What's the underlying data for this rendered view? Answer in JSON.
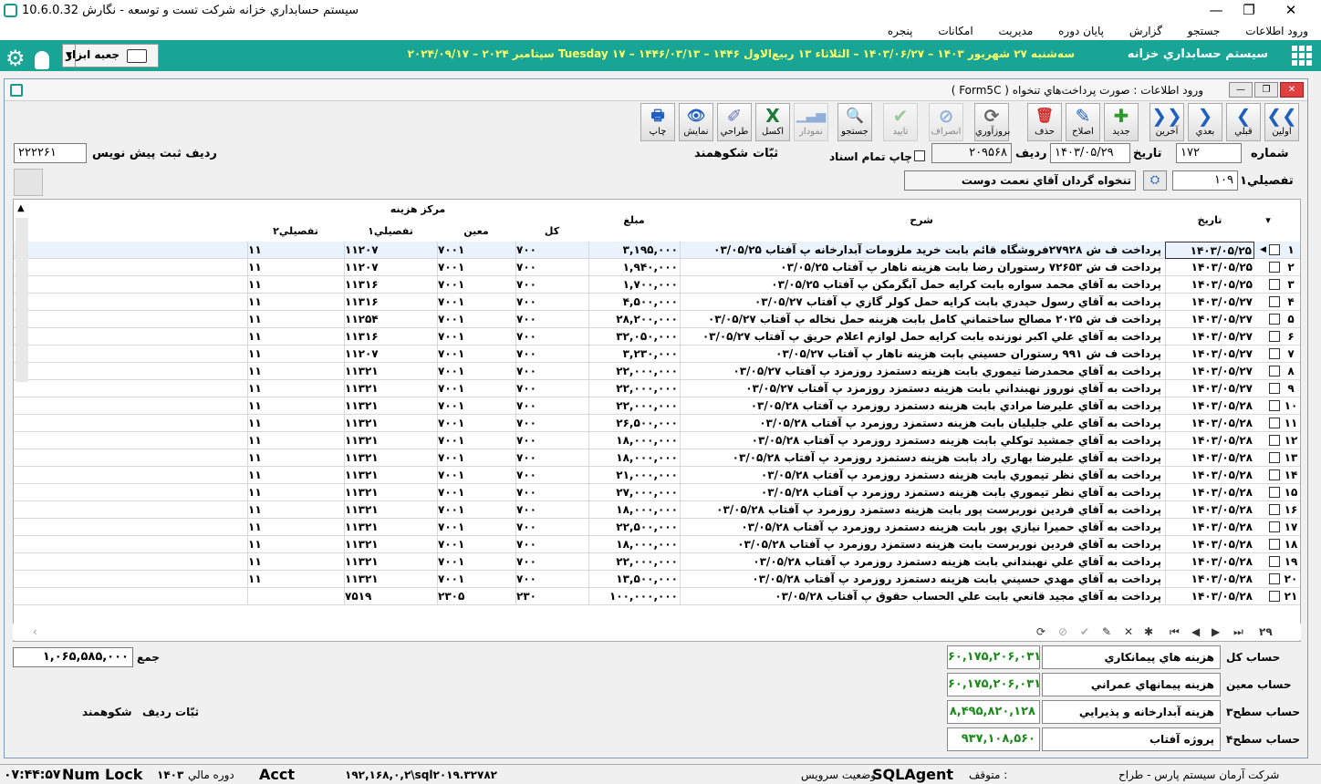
{
  "window": {
    "title": "سيستم حسابداري خزانه شرکت تست و توسعه - نگارش 10.6.0.32",
    "minimize": "—",
    "restore": "❐",
    "close": "✕"
  },
  "menu": [
    "ورود اطلاعات",
    "جستجو",
    "گزارش",
    "پايان دوره",
    "مديريت",
    "امکانات",
    "پنجره"
  ],
  "banner": {
    "system_name": "سيستم حسابداري خزانه",
    "date_line": "سه‌شنبه ۲۷ شهريور ۱۴۰۳ – ۱۴۰۳/۰۶/۲۷ – الثلاثاء ۱۳ ربيع‌الاول ۱۴۴۶ – ۱۴۴۶/۰۳/۱۳ – Tuesday ۱۷ سپتامبر ۲۰۲۴ – ۲۰۲۴/۰۹/۱۷",
    "toolbox_label": "جعبه ابزار",
    "toolbox_arrow": "▼"
  },
  "form": {
    "title": "ورود اطلاعات : صورت پرداخت‌هاي تنخواه ( Form5C )",
    "toolbar": [
      {
        "label": "اولين",
        "icon": "❮❮"
      },
      {
        "label": "قبلي",
        "icon": "❮"
      },
      {
        "label": "بعدي",
        "icon": "❯"
      },
      {
        "label": "آخرين",
        "icon": "❯❯"
      },
      {
        "label": "جديد",
        "icon": "✚"
      },
      {
        "label": "اصلاح",
        "icon": "✎"
      },
      {
        "label": "حذف",
        "icon": "🗑"
      },
      {
        "label": "بروزآوري",
        "icon": "⟳"
      },
      {
        "label": "انصراف",
        "icon": "⊘"
      },
      {
        "label": "تاييد",
        "icon": "✔"
      },
      {
        "label": "جستجو",
        "icon": "🔍"
      },
      {
        "label": "نمودار",
        "icon": "▁▃▅"
      },
      {
        "label": "اکسل",
        "icon": "X"
      },
      {
        "label": "طراحي",
        "icon": "✐"
      },
      {
        "label": "نمايش",
        "icon": "👁"
      },
      {
        "label": "چاپ",
        "icon": "🖶"
      }
    ],
    "header": {
      "number_label": "شماره",
      "number_value": "۱۷۲",
      "date_label": "تاريخ",
      "date_value": "۱۴۰۳/۰۵/۲۹",
      "row_label": "رديف",
      "row_value": "۲۰۹۵۶۸",
      "print_all_label": "چاپ تمام اسناد",
      "recorder_label": "ثبّات",
      "recorder_value": "شکوهمند",
      "prefill_label": "رديف ثبت پيش نويس",
      "prefill_value": "۲۲۲۲۶۱",
      "tafsili_label": "تفصيلي۱",
      "tafsili_code": "۱۰۹",
      "tafsili_name": "تنخواه گردان آقاي نعمت دوست"
    },
    "grid": {
      "headers": {
        "date": "تاريخ",
        "desc": "شرح",
        "amount": "مبلغ",
        "cost_center": "مرکز هزينه",
        "kol": "کل",
        "moeen": "معين",
        "tafsili1": "تفصيلي۱",
        "tafsili2": "تفصيلي۲"
      },
      "rows": [
        {
          "n": "۱",
          "date": "۱۴۰۳/۰۵/۲۵",
          "desc": "پرداخت ف ش ۲۷۹۲۸فروشگاه قائم بابت خريد ملزومات آبدارخانه پ آفتاب ۰۳/۰۵/۲۵",
          "amount": "۳,۱۹۵,۰۰۰",
          "kol": "۷۰۰",
          "moeen": "۷۰۰۱",
          "t1": "۱۱۲۰۷",
          "t2": "۱۱"
        },
        {
          "n": "۲",
          "date": "۱۴۰۳/۰۵/۲۵",
          "desc": "پرداخت ف ش ۷۲۶۵۳ رستوران رضا بابت هزينه ناهار پ آفتاب ۰۳/۰۵/۲۵",
          "amount": "۱,۹۴۰,۰۰۰",
          "kol": "۷۰۰",
          "moeen": "۷۰۰۱",
          "t1": "۱۱۲۰۷",
          "t2": "۱۱"
        },
        {
          "n": "۳",
          "date": "۱۴۰۳/۰۵/۲۵",
          "desc": "پرداخت به آقاي محمد سواره بابت کرايه حمل آبگرمکن پ آفتاب ۰۳/۰۵/۲۵",
          "amount": "۱,۷۰۰,۰۰۰",
          "kol": "۷۰۰",
          "moeen": "۷۰۰۱",
          "t1": "۱۱۳۱۶",
          "t2": "۱۱"
        },
        {
          "n": "۴",
          "date": "۱۴۰۳/۰۵/۲۷",
          "desc": "پرداخت به آقاي رسول حيدري بابت کرايه حمل کولر گازي پ آفتاب ۰۳/۰۵/۲۷",
          "amount": "۴,۵۰۰,۰۰۰",
          "kol": "۷۰۰",
          "moeen": "۷۰۰۱",
          "t1": "۱۱۳۱۶",
          "t2": "۱۱"
        },
        {
          "n": "۵",
          "date": "۱۴۰۳/۰۵/۲۷",
          "desc": "پرداخت ف ش ۲۰۲۵ مصالح ساختماني کامل بابت هزينه حمل نخاله پ آفتاب ۰۳/۰۵/۲۷",
          "amount": "۲۸,۲۰۰,۰۰۰",
          "kol": "۷۰۰",
          "moeen": "۷۰۰۱",
          "t1": "۱۱۲۵۴",
          "t2": "۱۱"
        },
        {
          "n": "۶",
          "date": "۱۴۰۳/۰۵/۲۷",
          "desc": "پرداخت به آقاي علي اکبر نوزنده بابت کرايه حمل لوازم اعلام حريق پ آفتاب ۰۳/۰۵/۲۷",
          "amount": "۳۲,۰۵۰,۰۰۰",
          "kol": "۷۰۰",
          "moeen": "۷۰۰۱",
          "t1": "۱۱۳۱۶",
          "t2": "۱۱"
        },
        {
          "n": "۷",
          "date": "۱۴۰۳/۰۵/۲۷",
          "desc": "پرداخت ف ش ۹۹۱ رستوران حسيني بابت هزينه ناهار پ آفتاب ۰۳/۰۵/۲۷",
          "amount": "۳,۲۳۰,۰۰۰",
          "kol": "۷۰۰",
          "moeen": "۷۰۰۱",
          "t1": "۱۱۲۰۷",
          "t2": "۱۱"
        },
        {
          "n": "۸",
          "date": "۱۴۰۳/۰۵/۲۷",
          "desc": "پرداخت به آقاي محمدرضا تيموري بابت هزينه دستمزد روزمزد پ آفتاب ۰۳/۰۵/۲۷",
          "amount": "۲۲,۰۰۰,۰۰۰",
          "kol": "۷۰۰",
          "moeen": "۷۰۰۱",
          "t1": "۱۱۳۲۱",
          "t2": "۱۱"
        },
        {
          "n": "۹",
          "date": "۱۴۰۳/۰۵/۲۷",
          "desc": "پرداخت به آقاي نوروز نهبنداني بابت هزينه دستمزد روزمزد پ آفتاب ۰۳/۰۵/۲۷",
          "amount": "۲۲,۰۰۰,۰۰۰",
          "kol": "۷۰۰",
          "moeen": "۷۰۰۱",
          "t1": "۱۱۳۲۱",
          "t2": "۱۱"
        },
        {
          "n": "۱۰",
          "date": "۱۴۰۳/۰۵/۲۸",
          "desc": "پرداخت به آقاي عليرضا مرادي بابت هزينه دستمزد روزمرد پ آفتاب ۰۳/۰۵/۲۸",
          "amount": "۲۲,۰۰۰,۰۰۰",
          "kol": "۷۰۰",
          "moeen": "۷۰۰۱",
          "t1": "۱۱۳۲۱",
          "t2": "۱۱"
        },
        {
          "n": "۱۱",
          "date": "۱۴۰۳/۰۵/۲۸",
          "desc": "پرداخت به آقاي علي جليليان بابت هزينه دستمزد روزمرد پ آفتاب ۰۳/۰۵/۲۸",
          "amount": "۲۶,۵۰۰,۰۰۰",
          "kol": "۷۰۰",
          "moeen": "۷۰۰۱",
          "t1": "۱۱۳۲۱",
          "t2": "۱۱"
        },
        {
          "n": "۱۲",
          "date": "۱۴۰۳/۰۵/۲۸",
          "desc": "پرداخت به آقاي جمشيد توکلي بابت هزينه دستمزد روزمرد پ آفتاب ۰۳/۰۵/۲۸",
          "amount": "۱۸,۰۰۰,۰۰۰",
          "kol": "۷۰۰",
          "moeen": "۷۰۰۱",
          "t1": "۱۱۳۲۱",
          "t2": "۱۱"
        },
        {
          "n": "۱۳",
          "date": "۱۴۰۳/۰۵/۲۸",
          "desc": "پرداخت به آقاي عليرضا بهاري راد بابت هزينه دستمزد روزمرد پ آفتاب ۰۳/۰۵/۲۸",
          "amount": "۱۸,۰۰۰,۰۰۰",
          "kol": "۷۰۰",
          "moeen": "۷۰۰۱",
          "t1": "۱۱۳۲۱",
          "t2": "۱۱"
        },
        {
          "n": "۱۴",
          "date": "۱۴۰۳/۰۵/۲۸",
          "desc": "پرداخت به آقاي نظر تيموري بابت هزينه دستمزد روزمرد پ آفتاب ۰۳/۰۵/۲۸",
          "amount": "۲۱,۰۰۰,۰۰۰",
          "kol": "۷۰۰",
          "moeen": "۷۰۰۱",
          "t1": "۱۱۳۲۱",
          "t2": "۱۱"
        },
        {
          "n": "۱۵",
          "date": "۱۴۰۳/۰۵/۲۸",
          "desc": "پرداخت به آقاي نظر تيموري بابت هزينه دستمزد روزمرد پ آفتاب ۰۳/۰۵/۲۸",
          "amount": "۲۷,۰۰۰,۰۰۰",
          "kol": "۷۰۰",
          "moeen": "۷۰۰۱",
          "t1": "۱۱۳۲۱",
          "t2": "۱۱"
        },
        {
          "n": "۱۶",
          "date": "۱۴۰۳/۰۵/۲۸",
          "desc": "پرداخت به آقاي فردين نوربرست پور بابت هزينه دستمزد روزمرد پ آفتاب ۰۳/۰۵/۲۸",
          "amount": "۱۸,۰۰۰,۰۰۰",
          "kol": "۷۰۰",
          "moeen": "۷۰۰۱",
          "t1": "۱۱۳۲۱",
          "t2": "۱۱"
        },
        {
          "n": "۱۷",
          "date": "۱۴۰۳/۰۵/۲۸",
          "desc": "پرداخت به آقاي حميرا نيازي پور بابت هزينه دستمزد روزمرد پ آفتاب ۰۳/۰۵/۲۸",
          "amount": "۲۲,۵۰۰,۰۰۰",
          "kol": "۷۰۰",
          "moeen": "۷۰۰۱",
          "t1": "۱۱۳۲۱",
          "t2": "۱۱"
        },
        {
          "n": "۱۸",
          "date": "۱۴۰۳/۰۵/۲۸",
          "desc": "پرداخت به آقاي فردين نوربرست بابت هزينه دستمزد روزمرد پ آفتاب ۰۳/۰۵/۲۸",
          "amount": "۱۸,۰۰۰,۰۰۰",
          "kol": "۷۰۰",
          "moeen": "۷۰۰۱",
          "t1": "۱۱۳۲۱",
          "t2": "۱۱"
        },
        {
          "n": "۱۹",
          "date": "۱۴۰۳/۰۵/۲۸",
          "desc": "پرداخت به آقاي علي نهبنداني بابت هزينه دستمزد روزمرد پ آفتاب ۰۳/۰۵/۲۸",
          "amount": "۲۲,۰۰۰,۰۰۰",
          "kol": "۷۰۰",
          "moeen": "۷۰۰۱",
          "t1": "۱۱۳۲۱",
          "t2": "۱۱"
        },
        {
          "n": "۲۰",
          "date": "۱۴۰۳/۰۵/۲۸",
          "desc": "پرداخت به آقاي مهدي حسيني بابت هزينه دستمزد روزمرد پ آفتاب ۰۳/۰۵/۲۸",
          "amount": "۱۳,۵۰۰,۰۰۰",
          "kol": "۷۰۰",
          "moeen": "۷۰۰۱",
          "t1": "۱۱۳۲۱",
          "t2": "۱۱"
        },
        {
          "n": "۲۱",
          "date": "۱۴۰۳/۰۵/۲۸",
          "desc": "پرداخت به آقاي مجيد قانعي بابت علي الحساب حقوق پ آفتاب ۰۳/۰۵/۲۸",
          "amount": "۱۰۰,۰۰۰,۰۰۰",
          "kol": "۲۳۰",
          "moeen": "۲۳۰۵",
          "t1": "۷۵۱۹",
          "t2": ""
        }
      ],
      "record_count": "۲۹"
    },
    "footer": {
      "total_label": "جمع",
      "total_value": "۱,۰۶۵,۵۸۵,۰۰۰",
      "recorder_label": "ثبّات رديف",
      "recorder_value": "شکوهمند",
      "accounts": [
        {
          "label": "حساب کل",
          "name": "هزينه هاي پيمانکاري",
          "value": "۶۰,۱۷۵,۲۰۶,۰۳۱"
        },
        {
          "label": "حساب معين",
          "name": "هزينه پيمانهاي عمراني",
          "value": "۶۰,۱۷۵,۲۰۶,۰۳۱"
        },
        {
          "label": "حساب سطح۳",
          "name": "هزينه آبدارخانه و پذيرايي",
          "value": "۸,۴۹۵,۸۲۰,۱۲۸"
        },
        {
          "label": "حساب سطح۴",
          "name": "پروژه آفتاب",
          "value": "۹۳۷,۱۰۸,۵۶۰"
        }
      ]
    }
  },
  "statusbar": {
    "time": "۰۷:۴۴:۵۷",
    "numlock": "Num Lock",
    "fiscal_label": "دوره مالي",
    "fiscal_value": "۱۴۰۳",
    "acct": "Acct",
    "db": "۱۹۲,۱۶۸,۰,۲\\sql۲۰۱۹.۳۲۷۸۲",
    "sql_agent": "SQLAgent",
    "service_status_label": "وضعيت سرويس",
    "service_status_value": "متوقف :",
    "company": "شرکت آرمان سيستم پارس - طراح"
  }
}
